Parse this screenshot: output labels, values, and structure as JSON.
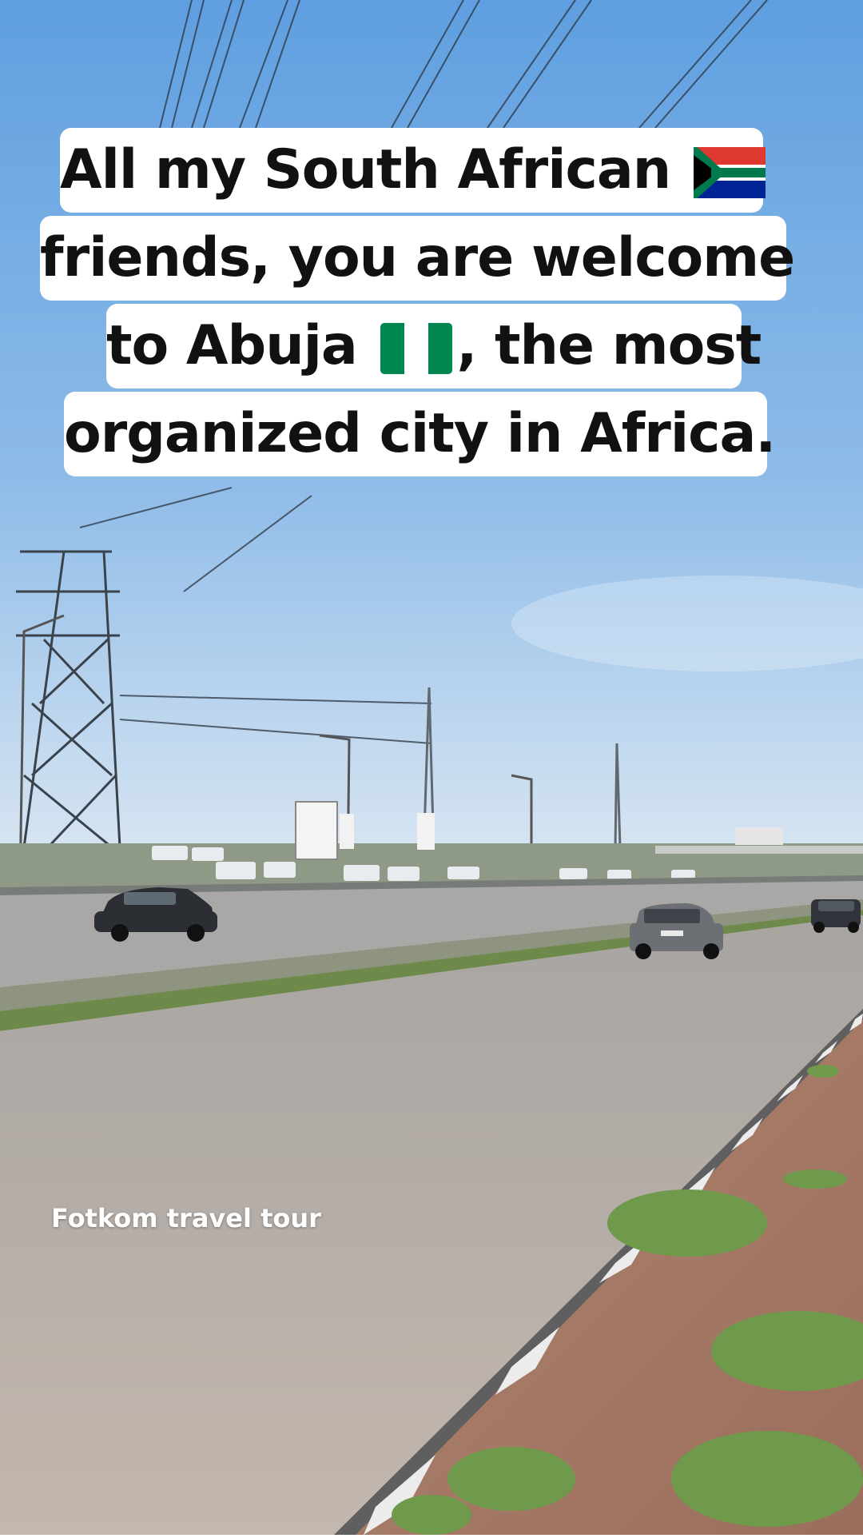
{
  "caption": {
    "line1_text": "All my South African",
    "line2_text": "friends, you are welcome",
    "line3_before": "to Abuja",
    "line3_after": ", the most",
    "line4_text": "organized city in Africa.",
    "flag1": "south-africa-flag",
    "flag2": "nigeria-flag"
  },
  "watermark": "Fotkom travel tour",
  "colors": {
    "sky_top": "#5f9fe0",
    "sky_horizon": "#d9e6f2",
    "road": "#b9b3ad",
    "dirt": "#a87c68",
    "grass": "#6f9a4c",
    "caption_bg": "#ffffff"
  }
}
